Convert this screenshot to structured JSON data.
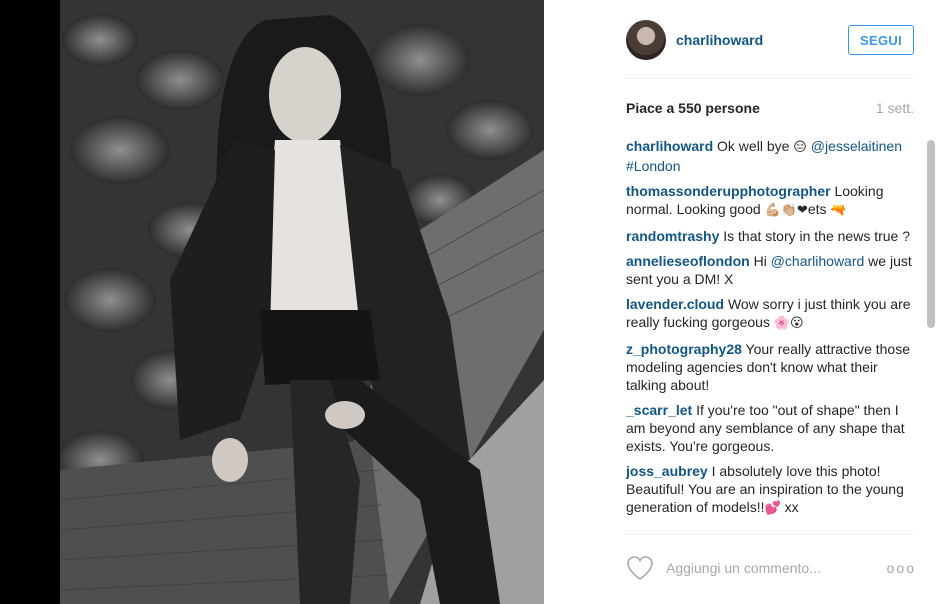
{
  "post": {
    "username": "charlihoward",
    "follow_label": "SEGUI",
    "likes_text": "Piace a 550 persone",
    "age": "1 sett."
  },
  "comments": [
    {
      "user": "charlihoward",
      "parts": [
        {
          "t": "Ok well bye ",
          "k": "text"
        },
        {
          "t": "😑",
          "k": "emoji"
        },
        {
          "t": " ",
          "k": "text"
        },
        {
          "t": "@jesselaitinen",
          "k": "mention"
        },
        {
          "t": " ",
          "k": "text"
        },
        {
          "t": "#London",
          "k": "hashtag"
        }
      ]
    },
    {
      "user": "thomassonderupphotographer",
      "parts": [
        {
          "t": "Looking normal. Looking good ",
          "k": "text"
        },
        {
          "t": "💪🏼👏🏼❤",
          "k": "emoji"
        },
        {
          "t": "ets ",
          "k": "text"
        },
        {
          "t": "🔫",
          "k": "emoji"
        }
      ]
    },
    {
      "user": "randomtrashy",
      "parts": [
        {
          "t": "Is that story in the news true ?",
          "k": "text"
        }
      ]
    },
    {
      "user": "annelieseoflondon",
      "parts": [
        {
          "t": "Hi ",
          "k": "text"
        },
        {
          "t": "@charlihoward",
          "k": "mention"
        },
        {
          "t": " we just sent you a DM! X",
          "k": "text"
        }
      ]
    },
    {
      "user": "lavender.cloud",
      "parts": [
        {
          "t": "Wow sorry i just think you are really fucking gorgeous ",
          "k": "text"
        },
        {
          "t": "🌸😮",
          "k": "emoji"
        }
      ]
    },
    {
      "user": "z_photography28",
      "parts": [
        {
          "t": "Your really attractive those modeling agencies don't know what their talking about!",
          "k": "text"
        }
      ]
    },
    {
      "user": "_scarr_let",
      "parts": [
        {
          "t": "If you're too \"out of shape\" then I am beyond any semblance of any shape that exists. You're gorgeous.",
          "k": "text"
        }
      ]
    },
    {
      "user": "joss_aubrey",
      "parts": [
        {
          "t": "I absolutely love this photo! Beautiful! You are an inspiration to the young generation of models!!",
          "k": "text"
        },
        {
          "t": "💕",
          "k": "emoji"
        },
        {
          "t": " xx",
          "k": "text"
        }
      ]
    }
  ],
  "footer": {
    "comment_placeholder": "Aggiungi un commento...",
    "more_label": "ooo"
  },
  "icons": {
    "like": "heart-icon",
    "more": "more-options-icon"
  },
  "colors": {
    "username": "#125688",
    "follow": "#3897f0",
    "muted": "#a5a7aa"
  }
}
